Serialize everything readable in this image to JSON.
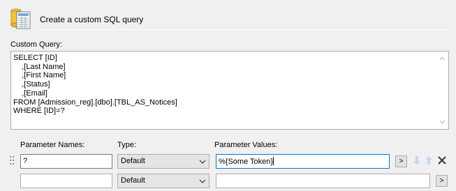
{
  "header": {
    "title": "Create a custom SQL query",
    "icon": "database-document-icon"
  },
  "query": {
    "label": "Custom Query:",
    "text": "SELECT [ID]\n    ,[Last Name]\n    ,[First Name]\n    ,[Status]\n    ,[Email]\nFROM [Admission_reg].[dbo].[TBL_AS_Notices]\nWHERE [ID]=?"
  },
  "params": {
    "headers": {
      "names": "Parameter Names:",
      "type": "Type:",
      "values": "Parameter Values:"
    },
    "rows": [
      {
        "name": "?",
        "type": "Default",
        "value": "%{Some Token}",
        "browse": ">"
      },
      {
        "name": "",
        "type": "Default",
        "value": "",
        "browse": ">"
      }
    ]
  },
  "colors": {
    "focus_border": "#0078d7",
    "arrow_disabled": "#c3d8ec",
    "delete": "#333333"
  }
}
